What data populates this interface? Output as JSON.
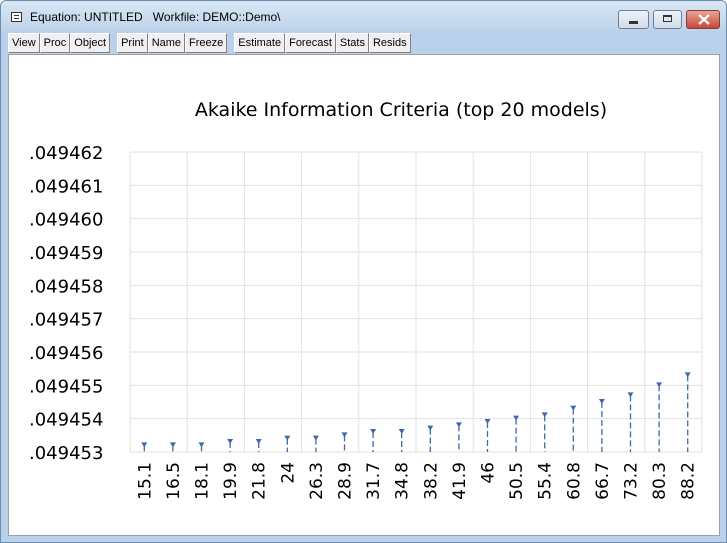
{
  "window": {
    "title": "Equation: UNTITLED   Workfile: DEMO::Demo\\"
  },
  "toolbar": {
    "buttons": [
      "View",
      "Proc",
      "Object",
      "Print",
      "Name",
      "Freeze",
      "Estimate",
      "Forecast",
      "Stats",
      "Resids"
    ]
  },
  "chart_data": {
    "type": "line",
    "title": "Akaike Information Criteria (top 20 models)",
    "categories": [
      "15.1",
      "16.5",
      "18.1",
      "19.9",
      "21.8",
      "24",
      "26.3",
      "28.9",
      "31.7",
      "34.8",
      "38.2",
      "41.9",
      "46",
      "50.5",
      "55.4",
      "60.8",
      "66.7",
      "73.2",
      "80.3",
      "88.2"
    ],
    "values": [
      0.0494532,
      0.0494532,
      0.0494532,
      0.0494533,
      0.0494533,
      0.0494534,
      0.0494534,
      0.0494535,
      0.0494536,
      0.0494536,
      0.0494537,
      0.0494538,
      0.0494539,
      0.049454,
      0.0494541,
      0.0494543,
      0.0494545,
      0.0494547,
      0.049455,
      0.0494553
    ],
    "yticks": [
      ".049462",
      ".049461",
      ".049460",
      ".049459",
      ".049458",
      ".049457",
      ".049456",
      ".049455",
      ".049454",
      ".049453"
    ],
    "ylim": [
      0.049453,
      0.049462
    ],
    "grid": true,
    "series_color": "#3f6aa6"
  }
}
